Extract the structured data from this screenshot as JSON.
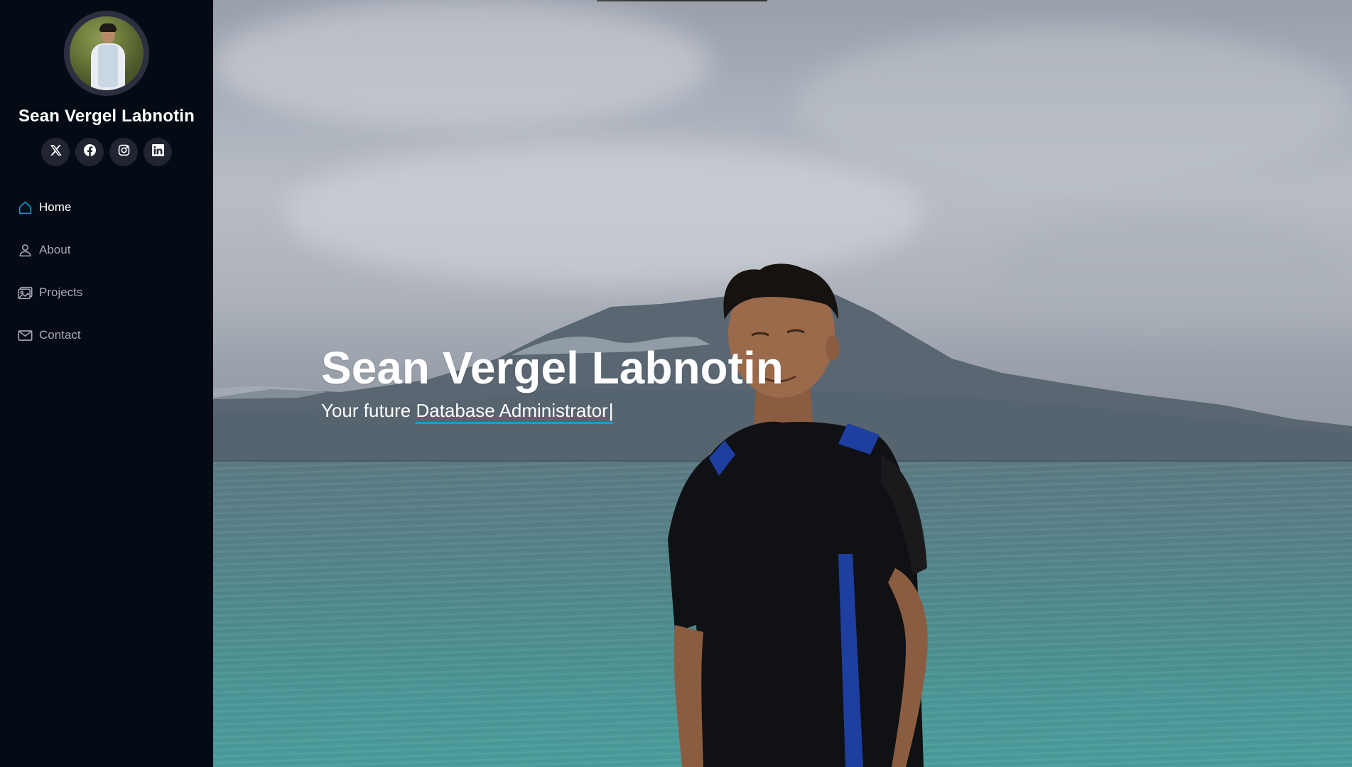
{
  "profile": {
    "name": "Sean Vergel Labnotin",
    "avatar_alt": "profile photo"
  },
  "social": [
    {
      "name": "x-icon"
    },
    {
      "name": "facebook-icon"
    },
    {
      "name": "instagram-icon"
    },
    {
      "name": "linkedin-icon"
    }
  ],
  "nav": {
    "items": [
      {
        "label": "Home",
        "icon": "house-icon",
        "active": true
      },
      {
        "label": "About",
        "icon": "person-icon",
        "active": false
      },
      {
        "label": "Projects",
        "icon": "images-icon",
        "active": false
      },
      {
        "label": "Contact",
        "icon": "envelope-icon",
        "active": false
      }
    ]
  },
  "hero": {
    "title": "Sean Vergel Labnotin",
    "subtitle_prefix": "Your future ",
    "typed_text": "Database Administrator",
    "cursor": "|"
  },
  "colors": {
    "sidebar_bg": "#040b14",
    "social_btn_bg": "#212431",
    "accent": "#149ddd",
    "nav_inactive": "#a8a9b4",
    "nav_active": "#ffffff"
  }
}
